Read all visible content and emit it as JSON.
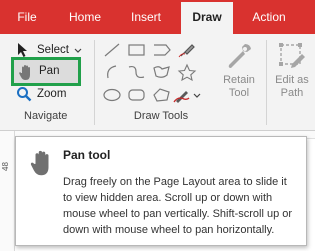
{
  "tabs": [
    {
      "label": "File"
    },
    {
      "label": "Home"
    },
    {
      "label": "Insert"
    },
    {
      "label": "Draw",
      "active": true
    },
    {
      "label": "Action"
    }
  ],
  "navigate": {
    "select_label": "Select",
    "pan_label": "Pan",
    "zoom_label": "Zoom",
    "group_label": "Navigate"
  },
  "draw_tools": {
    "group_label": "Draw Tools",
    "retain_label": "Retain\nTool",
    "edit_path_label": "Edit as\nPath"
  },
  "ruler": {
    "tick_label": "48"
  },
  "tooltip": {
    "title": "Pan tool",
    "body": "Drag freely on the Page Layout area to slide it to view hidden area. Scroll up or down with mouse wheel to pan vertically. Shift-scroll up or down with mouse wheel to pan horizontally."
  },
  "colors": {
    "tab_bar": "#d9322f",
    "highlight": "#21a04a",
    "ribbon_bg": "#f3f3f3",
    "zoom_icon": "#1b6fc2",
    "pen_accent": "#c62828"
  }
}
